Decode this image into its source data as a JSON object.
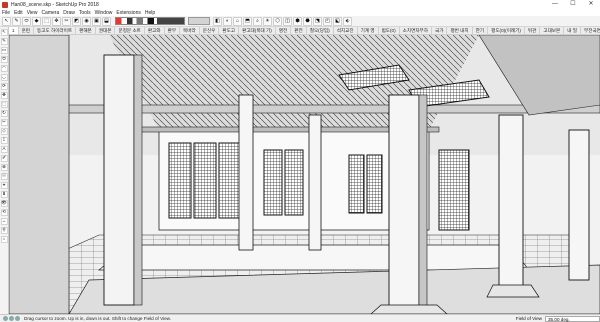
{
  "window": {
    "title": "Han08_scene.skp - SketchUp Pro 2018",
    "controls": [
      "—",
      "☐",
      "✕"
    ]
  },
  "menu": [
    "File",
    "Edit",
    "View",
    "Camera",
    "Draw",
    "Tools",
    "Window",
    "Extensions",
    "Help"
  ],
  "toolbar": {
    "icons": [
      "↖",
      "✎",
      "⬭",
      "◆",
      "⬚",
      "✥",
      "✂",
      "◩",
      "◉",
      "▣",
      "⬓"
    ],
    "icons2": [
      "◧",
      "◐",
      "⌂",
      "⬒",
      "⌕",
      "☀",
      "⬡",
      "◫",
      "⬢",
      "⬣",
      "⬔",
      "◰",
      "⬕",
      "⬖"
    ]
  },
  "scenes": [
    "1",
    "훈련",
    "등고도 하이라이트",
    "편해본",
    "권대본",
    "문정문 소트",
    "환고와",
    "환무",
    "북바라",
    "문신우",
    "환도고",
    "환고대(북대 기)",
    "명전",
    "판전",
    "철오(당입)",
    "석지교진",
    "기계 영",
    "범도(0)",
    "소치면자부하",
    "국가",
    "평번 내지",
    "한기",
    "평도(0)(이례기)",
    "뒤관",
    "고대보본",
    "내 밀",
    "부전국면",
    "배고",
    "부전국면",
    "학심도판",
    "임대물레 인장",
    "길동식 임대학인만",
    "종전",
    "밴내",
    "세무",
    "떡기가",
    "택가면",
    "기관",
    "영정"
  ],
  "scenes_active_index": 0,
  "left_tools": [
    "↖",
    "✎",
    "▭",
    "⬭",
    "◠",
    "◡",
    "⟳",
    "✥",
    "⬚",
    "↻",
    "✂",
    "◇",
    "⟟",
    "A",
    "✐",
    "⊕",
    "☉",
    "⌖",
    "⬇",
    "👁",
    "⟲",
    "↔",
    "⚲",
    "⌂"
  ],
  "status": {
    "text": "Drag cursor to zoom.  Up is in, down is out. Shift to change Field of View.",
    "measure_label": "Field of View",
    "measure_value": "35.00 deg."
  },
  "colors": {
    "sketch_line": "#1b1b1b",
    "fill": "#ffffff",
    "ground": "#e6e6e6"
  }
}
